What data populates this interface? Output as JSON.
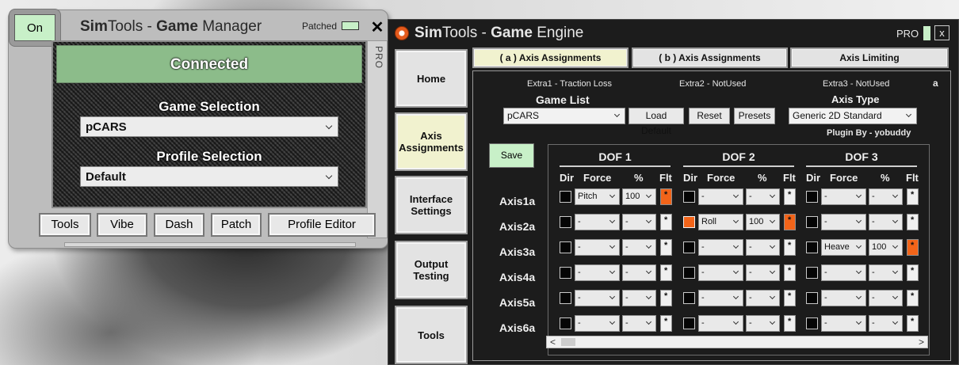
{
  "game_manager": {
    "on_label": "On",
    "title_prefix": "Sim",
    "title_mid": "Tools - ",
    "title_bold": "Game",
    "title_suffix": " Manager",
    "patched_label": "Patched",
    "close_label": "✕",
    "pro_label": "PRO",
    "status": "Connected",
    "game_selection_label": "Game Selection",
    "game_selection_value": "pCARS",
    "profile_selection_label": "Profile Selection",
    "profile_selection_value": "Default",
    "buttons": [
      "Tools",
      "Vibe",
      "Dash",
      "Patch",
      "Profile Editor"
    ],
    "colors": {
      "connected": "#8cbc8a",
      "indicator": "#c8f0c8"
    }
  },
  "game_engine": {
    "title_prefix": "Sim",
    "title_mid": "Tools - ",
    "title_bold": "Game",
    "title_suffix": " Engine",
    "pro_label": "PRO",
    "close_label": "x",
    "nav": [
      "Home",
      "Axis Assignments",
      "Interface Settings",
      "Output Testing",
      "Tools"
    ],
    "active_nav": "Axis Assignments",
    "tabs": [
      "( a ) Axis Assignments",
      "( b ) Axis Assignments",
      "Axis Limiting"
    ],
    "active_tab": "( a ) Axis Assignments",
    "extras": [
      "Extra1 - Traction Loss",
      "Extra2 - NotUsed",
      "Extra3 - NotUsed"
    ],
    "corner_label": "a",
    "game_list_label": "Game List",
    "game_list_value": "pCARS",
    "load_default_label": "Load Default",
    "reset_label": "Reset",
    "presets_label": "Presets",
    "axis_type_label": "Axis Type",
    "axis_type_value": "Generic 2D Standard",
    "plugin_by": "Plugin By - yobuddy",
    "save_label": "Save",
    "dof_titles": [
      "DOF 1",
      "DOF 2",
      "DOF 3"
    ],
    "col_headers": {
      "dir": "Dir",
      "force": "Force",
      "pct": "%",
      "flt": "Flt"
    },
    "axes": [
      {
        "name": "Axis1a",
        "dofs": [
          {
            "dir": false,
            "force": "Pitch",
            "pct": "100",
            "flt": true
          },
          {
            "dir": false,
            "force": "-",
            "pct": "-",
            "flt": false
          },
          {
            "dir": false,
            "force": "-",
            "pct": "-",
            "flt": false
          }
        ]
      },
      {
        "name": "Axis2a",
        "dofs": [
          {
            "dir": false,
            "force": "-",
            "pct": "-",
            "flt": false
          },
          {
            "dir": true,
            "force": "Roll",
            "pct": "100",
            "flt": true
          },
          {
            "dir": false,
            "force": "-",
            "pct": "-",
            "flt": false
          }
        ]
      },
      {
        "name": "Axis3a",
        "dofs": [
          {
            "dir": false,
            "force": "-",
            "pct": "-",
            "flt": false
          },
          {
            "dir": false,
            "force": "-",
            "pct": "-",
            "flt": false
          },
          {
            "dir": false,
            "force": "Heave",
            "pct": "100",
            "flt": true
          }
        ]
      },
      {
        "name": "Axis4a",
        "dofs": [
          {
            "dir": false,
            "force": "-",
            "pct": "-",
            "flt": false
          },
          {
            "dir": false,
            "force": "-",
            "pct": "-",
            "flt": false
          },
          {
            "dir": false,
            "force": "-",
            "pct": "-",
            "flt": false
          }
        ]
      },
      {
        "name": "Axis5a",
        "dofs": [
          {
            "dir": false,
            "force": "-",
            "pct": "-",
            "flt": false
          },
          {
            "dir": false,
            "force": "-",
            "pct": "-",
            "flt": false
          },
          {
            "dir": false,
            "force": "-",
            "pct": "-",
            "flt": false
          }
        ]
      },
      {
        "name": "Axis6a",
        "dofs": [
          {
            "dir": false,
            "force": "-",
            "pct": "-",
            "flt": false
          },
          {
            "dir": false,
            "force": "-",
            "pct": "-",
            "flt": false
          },
          {
            "dir": false,
            "force": "-",
            "pct": "-",
            "flt": false
          }
        ]
      }
    ],
    "scroll_left": "<",
    "scroll_right": ">",
    "colors": {
      "active_highlight": "#f1f2cf",
      "orange": "#f26419",
      "save_green": "#c8f0c8"
    }
  }
}
